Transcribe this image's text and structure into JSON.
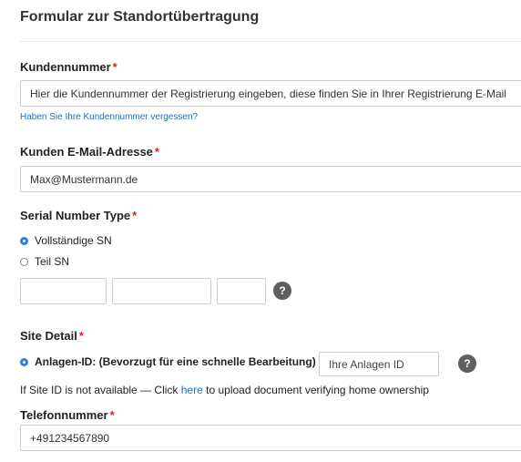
{
  "form": {
    "title": "Formular zur Standortübertragung",
    "required_mark": "*",
    "customer_number": {
      "label": "Kundennummer",
      "placeholder": "Hier die Kundennummer der Registrierung eingeben, diese finden Sie in Ihrer Registrierung E-Mail",
      "forgot_link": "Haben Sie Ihre Kundennummer vergessen?"
    },
    "email": {
      "label": "Kunden E-Mail-Adresse",
      "value": "Max@Mustermann.de"
    },
    "serial_number": {
      "label": "Serial Number Type",
      "options": [
        "Vollständige SN",
        "Teil SN"
      ],
      "selected": "Vollständige SN",
      "help_glyph": "?"
    },
    "site_detail": {
      "label": "Site Detail",
      "option_label": "Anlagen-ID: (Bevorzugt für eine schnelle Bearbeitung)",
      "input_placeholder": "Ihre Anlagen ID",
      "help_glyph": "?",
      "note_before": "If Site ID is not available — Click",
      "note_link": "here",
      "note_after": "to upload document verifying home ownership"
    },
    "phone": {
      "label": "Telefonnummer",
      "value": "+491234567890"
    }
  },
  "colors": {
    "accent": "#2f7fe0",
    "link": "#1f6fb8",
    "required": "#e02020",
    "help_bg": "#5f5f5f"
  },
  "icons": {
    "help": "question-circle-icon",
    "radio_selected": "radio-selected-icon",
    "radio_unselected": "radio-unselected-icon"
  }
}
